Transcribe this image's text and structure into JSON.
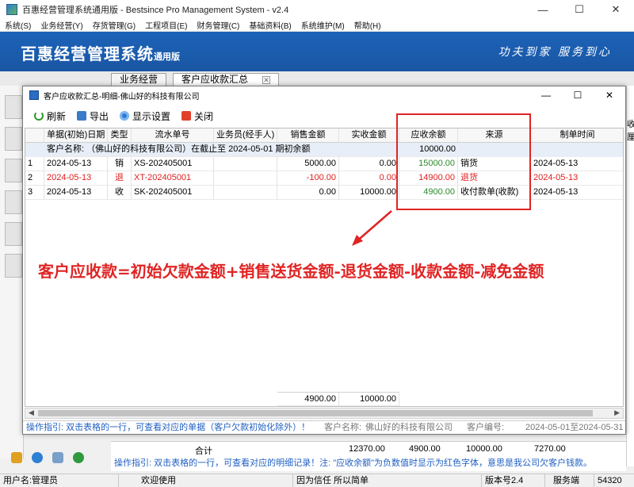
{
  "window": {
    "title": "百惠经营管理系统通用版 - Bestsince Pro Management System - v2.4",
    "controls": [
      "—",
      "☐",
      "✕"
    ]
  },
  "menu": [
    "系统(S)",
    "业务经营(Y)",
    "存货管理(G)",
    "工程项目(E)",
    "财务管理(C)",
    "基础资料(B)",
    "系统维护(M)",
    "帮助(H)"
  ],
  "banner": {
    "app_name": "百惠经营管理系统",
    "edition": "通用版",
    "slogan": "功夫到家 服务到心"
  },
  "outer_tabs": [
    "业务经营",
    "客户应收款汇总"
  ],
  "dialog": {
    "title": "客户应收款汇总-明细-佛山好的科技有限公司",
    "toolbar": {
      "refresh": "刷新",
      "export": "导出",
      "display_settings": "显示设置",
      "close": "关闭"
    },
    "columns": [
      "单据(初始)日期",
      "类型",
      "流水单号",
      "业务员(经手人)",
      "销售金额",
      "实收金额",
      "应收余额",
      "来源",
      "制单时间"
    ],
    "summary_row": {
      "text": "客户名称: （佛山好的科技有限公司）在截止至 2024-05-01 期初余额",
      "balance": "10000.00"
    },
    "rows": [
      {
        "no": "1",
        "date": "2024-05-13",
        "type": "销",
        "serial": "XS-202405001",
        "staff": "",
        "sales": "5000.00",
        "received": "0.00",
        "balance": "15000.00",
        "source": "销货",
        "created": "2024-05-13",
        "style": "normal"
      },
      {
        "no": "2",
        "date": "2024-05-13",
        "type": "退",
        "serial": "XT-202405001",
        "staff": "",
        "sales": "-100.00",
        "received": "0.00",
        "balance": "14900.00",
        "source": "退货",
        "created": "2024-05-13",
        "style": "red"
      },
      {
        "no": "3",
        "date": "2024-05-13",
        "type": "收",
        "serial": "SK-202405001",
        "staff": "",
        "sales": "0.00",
        "received": "10000.00",
        "balance": "4900.00",
        "source": "收付款单(收款)",
        "created": "2024-05-13",
        "style": "normal"
      }
    ],
    "totals": {
      "sales": "4900.00",
      "received": "10000.00"
    },
    "status": {
      "guide": "操作指引: 双击表格的一行，可查看对应的单据（客户欠款初始化除外）！",
      "customer_label": "客户名称:",
      "customer_name": "佛山好的科技有限公司",
      "customer_code_label": "客户编号:",
      "date_range": "2024-05-01至2024-05-31"
    }
  },
  "annotation": {
    "formula": "客户应收款=初始欠款金额+销售送货金额-退货金额-收款金额-减免金额",
    "color": "#e02424"
  },
  "main_bottom": {
    "total_label": "合计",
    "total_values": [
      "12370.00",
      "4900.00",
      "10000.00",
      "7270.00"
    ],
    "guide": "操作指引: 双击表格的一行，可查看对应的明细记录！注: \"应收余额\"为负数值时显示为红色字体，意思是我公司欠客户钱款。",
    "right_fragment": "收厘"
  },
  "statusbar": {
    "user": "用户名:管理员",
    "welcome": "欢迎使用",
    "motto": "因为信任 所以简单",
    "version": "版本号2.4",
    "mode": "服务端",
    "extra": "54320"
  }
}
